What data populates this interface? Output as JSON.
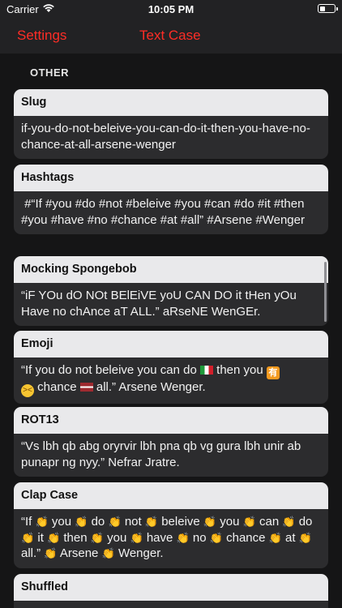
{
  "status_bar": {
    "carrier": "Carrier",
    "time": "10:05 PM"
  },
  "nav": {
    "back_label": "Settings",
    "title": "Text Case"
  },
  "section": {
    "header": "OTHER"
  },
  "cards": {
    "slug": {
      "title": "Slug",
      "text": "if-you-do-not-beleive-you-can-do-it-then-you-have-no-chance-at-all-arsene-wenger"
    },
    "hashtags": {
      "title": "Hashtags",
      "text": " #“If #you #do #not #beleive #you #can #do #it #then #you #have #no #chance #at #all” #Arsene #Wenger"
    },
    "mocking": {
      "title": "Mocking Spongebob",
      "text": "“iF YOu dO NOt BElEiVE yoU CAN DO it tHen yOu Have no chAnce aT ALL.” aRseNE WenGEr."
    },
    "emoji": {
      "title": "Emoji",
      "part1": "“If you do not beleive you can do ",
      "part2": " then you ",
      "part3": " chance ",
      "part4": " all.” Arsene Wenger.",
      "icon_yu": "有",
      "icon_face": "><"
    },
    "rot13": {
      "title": "ROT13",
      "text": "“Vs lbh qb abg oryrvir lbh pna qb vg gura lbh unir ab punapr ng nyy.” Nefrar Jratre."
    },
    "clap": {
      "title": "Clap Case",
      "clap_icon": "👏",
      "words": [
        "“If",
        "you",
        "do",
        "not",
        "beleive",
        "you",
        "can",
        "do",
        "it",
        "then",
        "you",
        "have",
        "no",
        "chance",
        "at",
        "all.”",
        "Arsene",
        "Wenger."
      ]
    },
    "shuffled": {
      "title": "Shuffled"
    }
  },
  "colors": {
    "accent": "#ff2d26",
    "card_header": "#e9e9eb",
    "card_body": "#2c2c2e",
    "background": "#151516"
  }
}
